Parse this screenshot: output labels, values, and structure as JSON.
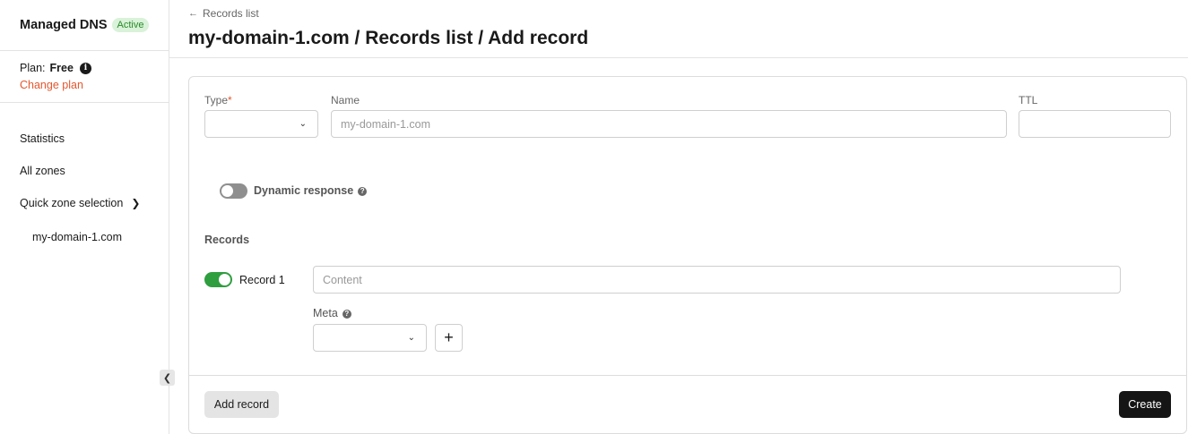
{
  "sidebar": {
    "title": "Managed DNS",
    "status_badge": "Active",
    "plan_label": "Plan:",
    "plan_value": "Free",
    "change_plan": "Change plan",
    "nav": {
      "statistics": "Statistics",
      "all_zones": "All zones",
      "quick_zone": "Quick zone selection",
      "zone_item": "my-domain-1.com"
    }
  },
  "header": {
    "back_link": "Records list",
    "title": "my-domain-1.com / Records list / Add record"
  },
  "form": {
    "type_label": "Type",
    "required_mark": "*",
    "name_label": "Name",
    "name_placeholder": "my-domain-1.com",
    "ttl_label": "TTL",
    "dynamic_response_label": "Dynamic response",
    "dynamic_response_enabled": false,
    "records_title": "Records",
    "records": [
      {
        "label": "Record 1",
        "enabled": true,
        "content_placeholder": "Content",
        "meta_label": "Meta"
      }
    ]
  },
  "actions": {
    "add_record": "Add record",
    "create": "Create"
  },
  "colors": {
    "accent_link": "#e4572e",
    "badge_bg": "#d9f2d9",
    "badge_text": "#2a8a2a",
    "toggle_on": "#2f9e3f",
    "toggle_off": "#8f8f8f",
    "primary_button": "#151515"
  }
}
